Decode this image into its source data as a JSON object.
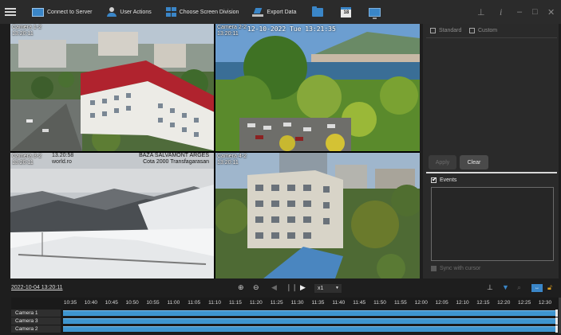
{
  "toolbar": {
    "connect_label": "Connect to Server",
    "user_actions_label": "User Actions",
    "screen_division_label": "Choose Screen Division",
    "export_label": "Export Data",
    "calendar_day": "18"
  },
  "window_controls": {
    "pin": "⊥",
    "info": "i",
    "minimize": "–",
    "maximize": "□",
    "close": "✕"
  },
  "cameras": [
    {
      "name": "Camera 1-2",
      "time": "13:20:11"
    },
    {
      "name": "Camera 2-2",
      "time": "13:20:11",
      "overlay_timestamp": "12-10-2022 Tue 13:21:35"
    },
    {
      "name": "Camera 3-2",
      "time": "13:20:11",
      "overlay_left": "13.20:58",
      "overlay_left2": "world.ro",
      "overlay_right": "BAZA SALVAMONT ARGES",
      "overlay_right2": "Cota 2000 Transfagarasan"
    },
    {
      "name": "Camera 4-2",
      "time": "13:20:11"
    }
  ],
  "right_panel": {
    "standard_label": "Standard",
    "custom_label": "Custom",
    "apply_label": "Apply",
    "clear_label": "Clear",
    "events_label": "Events",
    "sync_label": "Sync with cursor"
  },
  "playback": {
    "date": "2022-10-04 13:20:11",
    "speed": "x1"
  },
  "timeline": {
    "ticks": [
      "10:35",
      "10:40",
      "10:45",
      "10:50",
      "10:55",
      "11:00",
      "11:05",
      "11:10",
      "11:15",
      "11:20",
      "11:25",
      "11:30",
      "11:35",
      "11:40",
      "11:45",
      "11:50",
      "11:55",
      "12:00",
      "12:05",
      "12:10",
      "12:15",
      "12:20",
      "12:25",
      "12:30"
    ],
    "tracks": [
      "Camera 1",
      "Camera 3",
      "Camera 2"
    ]
  },
  "colors": {
    "accent": "#3a86c8",
    "track": "#3e95cf",
    "panel": "#2a2a2a",
    "background": "#1e1e1e"
  }
}
